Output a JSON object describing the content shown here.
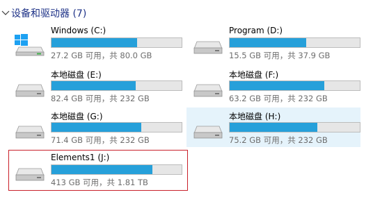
{
  "group": {
    "title": "设备和驱动器 (7)",
    "icon": "chevron-down-icon"
  },
  "colors": {
    "bar_fill": "#26a0da",
    "bar_track": "#e6e6e6",
    "selected_bg": "#e5f3fb",
    "outline": "#c9202a",
    "header_text": "#1e3287"
  },
  "drives": [
    {
      "name": "Windows (C:)",
      "info": "27.2 GB 可用，共 80.0 GB",
      "used_fraction": 0.66,
      "icon": "windows-drive-icon"
    },
    {
      "name": "Program (D:)",
      "info": "15.5 GB 可用，共 37.9 GB",
      "used_fraction": 0.59,
      "icon": "hard-drive-icon"
    },
    {
      "name": "本地磁盘 (E:)",
      "info": "82.4 GB 可用，共 232 GB",
      "used_fraction": 0.645,
      "icon": "hard-drive-icon"
    },
    {
      "name": "本地磁盘 (F:)",
      "info": "63.2 GB 可用，共 232 GB",
      "used_fraction": 0.728,
      "icon": "hard-drive-icon"
    },
    {
      "name": "本地磁盘 (G:)",
      "info": "71.4 GB 可用，共 232 GB",
      "used_fraction": 0.692,
      "icon": "hard-drive-icon"
    },
    {
      "name": "本地磁盘 (H:)",
      "info": "75.2 GB 可用，共 232 GB",
      "used_fraction": 0.676,
      "icon": "hard-drive-icon"
    },
    {
      "name": "Elements1 (J:)",
      "info": "413 GB 可用，共 1.81 TB",
      "used_fraction": 0.777,
      "icon": "hard-drive-icon"
    }
  ]
}
